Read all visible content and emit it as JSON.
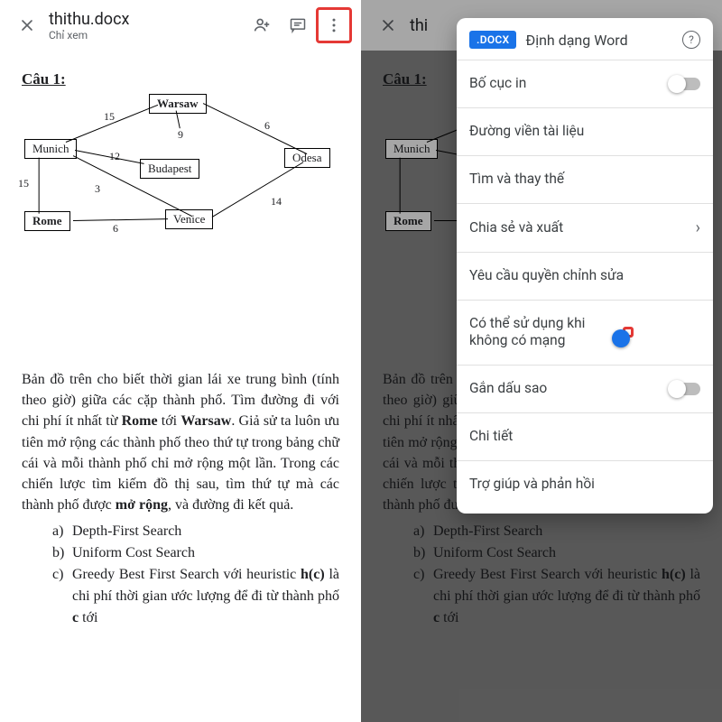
{
  "doc": {
    "title": "thithu.docx",
    "subtitle": "Chỉ xem",
    "title_cut": "thi"
  },
  "question": {
    "label": "Câu 1:",
    "paragraph_parts": {
      "p1": "Bản đồ trên cho biết thời gian lái xe trung bình (tính theo giờ) giữa các cặp thành phố. Tìm đường đi với chi phí ít nhất từ ",
      "p2": "Rome",
      "p3": " tới ",
      "p4": "Warsaw",
      "p5": ". Giả sử ta luôn ưu tiên mở rộng các thành phố theo thứ tự trong bảng chữ cái và mỗi thành phố chỉ mở rộng một lần. Trong các chiến lược tìm kiếm đồ thị sau, tìm thứ tự mà các thành phố được ",
      "p6": "mở rộng",
      "p7": ", và đường đi kết quả."
    },
    "options": {
      "a_lbl": "a)",
      "a_txt": "Depth-First Search",
      "b_lbl": "b)",
      "b_txt": "Uniform Cost Search",
      "c_lbl": "c)",
      "c_txt_pre": "Greedy Best First Search với heuristic ",
      "c_bold": "h(c)",
      "c_txt_mid": " là chi phí thời gian ước lượng để đi từ  thành phố ",
      "c_bold2": "c",
      "c_txt_post": " tới"
    }
  },
  "graph": {
    "nodes": {
      "warsaw": "Warsaw",
      "munich": "Munich",
      "budapest": "Budapest",
      "odesa": "Odesa",
      "rome": "Rome",
      "venice": "Venice"
    },
    "edge_labels": {
      "mw": "15",
      "wb": "9",
      "wo": "6",
      "mb": "12",
      "mr": "15",
      "mv": "3",
      "rv": "6",
      "vo": "14"
    }
  },
  "menu": {
    "badge": ".DOCX",
    "title": "Định dạng Word",
    "items": {
      "print_layout": "Bố cục in",
      "doc_outline": "Đường viền tài liệu",
      "find_replace": "Tìm và thay thế",
      "share_export": "Chia sẻ và xuất",
      "request_edit": "Yêu cầu quyền chỉnh sửa",
      "offline": "Có thể sử dụng khi không có mạng",
      "star": "Gắn dấu sao",
      "details": "Chi tiết",
      "help": "Trợ giúp và phản hồi"
    }
  }
}
